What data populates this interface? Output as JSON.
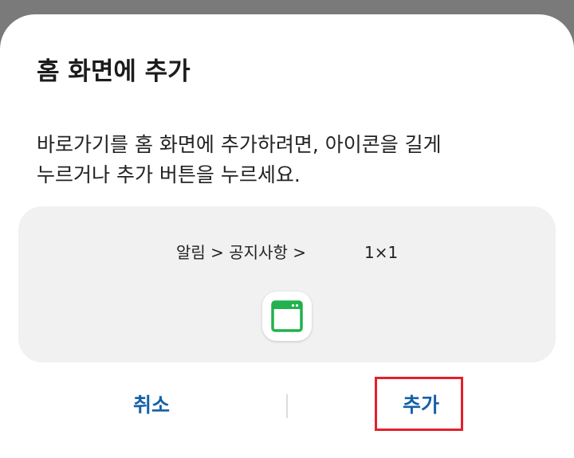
{
  "dialog": {
    "title": "홈 화면에 추가",
    "message_line1": "바로가기를 홈 화면에 추가하려면, 아이콘을 길게",
    "message_line2": "누르거나 추가 버튼을 누르세요."
  },
  "preview": {
    "shortcut_label": "알림 > 공지사항 >",
    "size_label": "1×1",
    "icon": "app-window-icon",
    "icon_color": "#22b14c"
  },
  "buttons": {
    "cancel_label": "취소",
    "add_label": "추가"
  },
  "colors": {
    "button_text": "#1560a8",
    "highlight_border": "#e3202a"
  }
}
